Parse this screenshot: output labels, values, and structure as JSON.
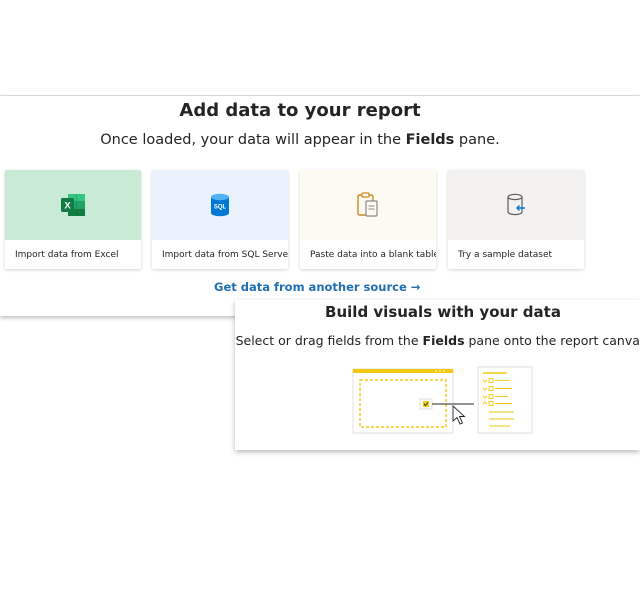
{
  "add_data": {
    "title": "Add data to your report",
    "subtitle_before": "Once loaded, your data will appear in the ",
    "subtitle_bold": "Fields",
    "subtitle_after": " pane.",
    "tiles": [
      {
        "label": "Import data from Excel",
        "icon": "excel-icon",
        "bg": "#c9ead5"
      },
      {
        "label": "Import data from SQL Server",
        "icon": "sql-server-icon",
        "bg": "#eaf3fd"
      },
      {
        "label": "Paste data into a blank table",
        "icon": "clipboard-icon",
        "bg": "#fdfbf1"
      },
      {
        "label": "Try a sample dataset",
        "icon": "sample-dataset-icon",
        "bg": "#f3f2f1"
      }
    ],
    "link": "Get data from another source →",
    "link_color": "#1f6fb2"
  },
  "build_visuals": {
    "title": "Build visuals with your data",
    "subtitle_before": "Select or drag fields from the ",
    "subtitle_bold": "Fields",
    "subtitle_after": " pane onto the report canvas.",
    "illustration": "drag-fields-illustration",
    "accent": "#f2c811"
  },
  "sql_badge": "SQL",
  "excel_letter": "X"
}
